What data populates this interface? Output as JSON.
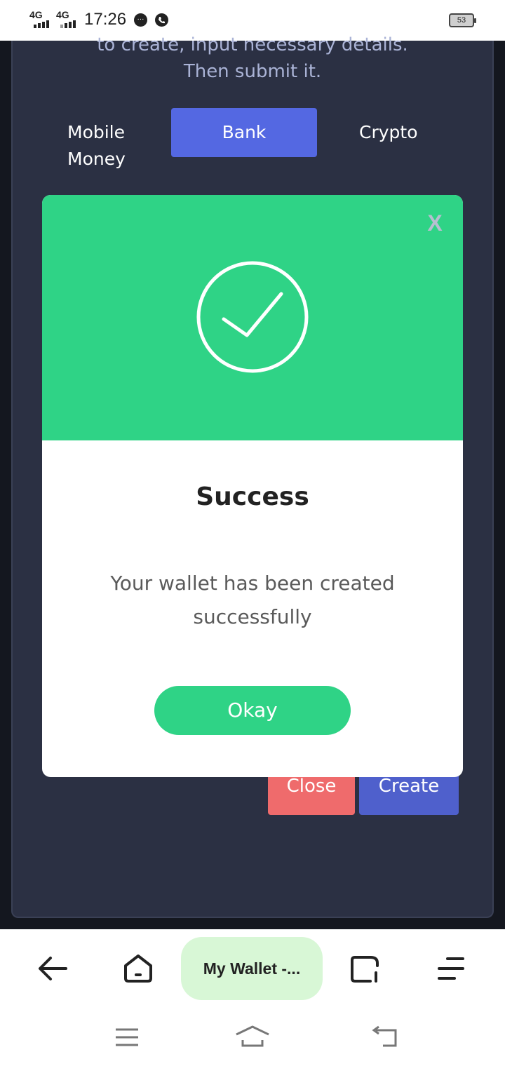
{
  "status_bar": {
    "network1": "4G",
    "network2": "4G",
    "time": "17:26",
    "battery": "53"
  },
  "instructions": {
    "line1": "to create, input necessary details.",
    "line2": "Then submit it."
  },
  "tabs": {
    "mobile_line1": "Mobile",
    "mobile_line2": "Money",
    "bank": "Bank",
    "crypto": "Crypto",
    "active": "Bank"
  },
  "form_buttons": {
    "close": "Close",
    "create": "Create"
  },
  "modal": {
    "close_label": "X",
    "title": "Success",
    "message": "Your wallet has been created successfully",
    "ok_button": "Okay",
    "header_color": "#2fd386"
  },
  "browser": {
    "tab_title": "My Wallet -..."
  },
  "colors": {
    "accent": "#5468e2",
    "success": "#2fd386",
    "danger": "#ef6b6c",
    "page_bg": "#2b3043"
  }
}
